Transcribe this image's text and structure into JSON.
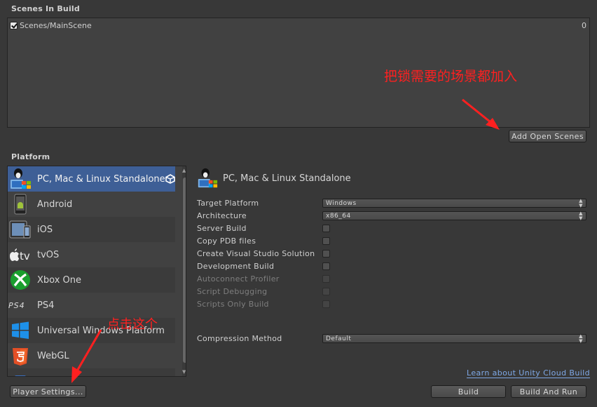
{
  "scenes": {
    "title": "Scenes In Build",
    "items": [
      {
        "name": "Scenes/MainScene",
        "index": "0",
        "checked": true
      }
    ],
    "add_open_scenes_label": "Add Open Scenes"
  },
  "annotations": {
    "top": "把锁需要的场景都加入",
    "bottom": "点击这个",
    "color": "#ff2020"
  },
  "platform": {
    "title": "Platform",
    "items": [
      {
        "label": "PC, Mac & Linux Standalone",
        "icon": "pc-mac-linux-icon",
        "selected": true
      },
      {
        "label": "Android",
        "icon": "android-icon"
      },
      {
        "label": "iOS",
        "icon": "ios-icon"
      },
      {
        "label": "tvOS",
        "icon": "tvos-icon"
      },
      {
        "label": "Xbox One",
        "icon": "xbox-icon"
      },
      {
        "label": "PS4",
        "icon": "ps4-icon"
      },
      {
        "label": "Universal Windows Platform",
        "icon": "windows-icon"
      },
      {
        "label": "WebGL",
        "icon": "html5-icon"
      }
    ],
    "selected_color": "#3e5f96"
  },
  "settings": {
    "header": "PC, Mac & Linux Standalone",
    "target_platform": {
      "label": "Target Platform",
      "value": "Windows"
    },
    "architecture": {
      "label": "Architecture",
      "value": "x86_64"
    },
    "server_build": "Server Build",
    "copy_pdb": "Copy PDB files",
    "create_vs": "Create Visual Studio Solution",
    "development_build": "Development Build",
    "autoconnect_profiler": "Autoconnect Profiler",
    "script_debugging": "Script Debugging",
    "scripts_only": "Scripts Only Build",
    "compression": {
      "label": "Compression Method",
      "value": "Default"
    }
  },
  "footer": {
    "cloud_link": "Learn about Unity Cloud Build",
    "player_settings": "Player Settings...",
    "build": "Build",
    "build_and_run": "Build And Run"
  }
}
